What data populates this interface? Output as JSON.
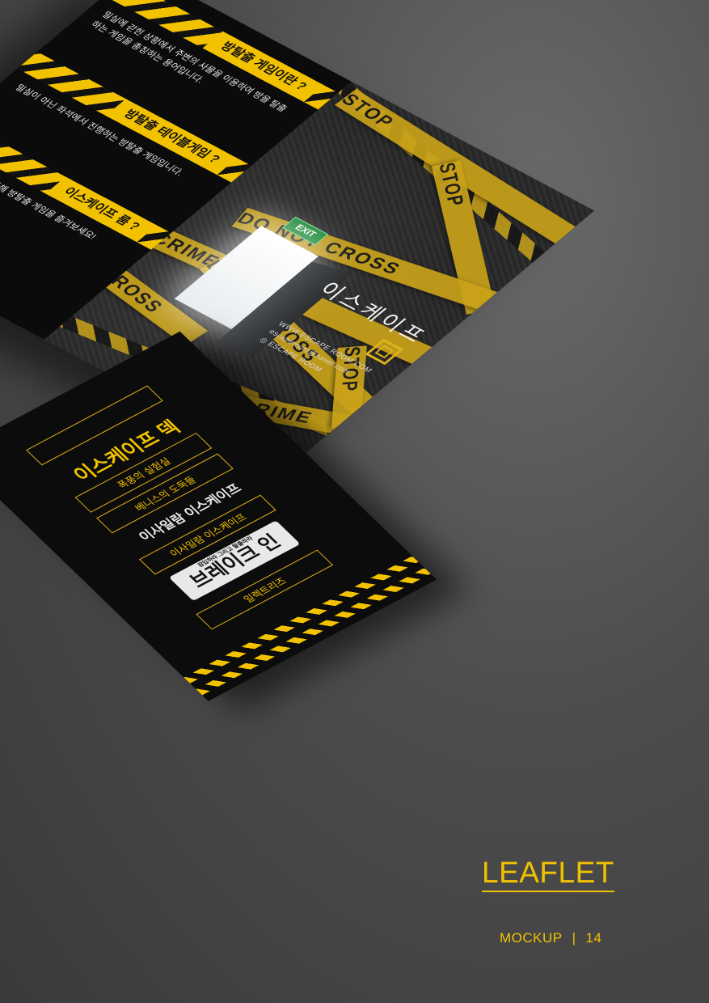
{
  "main_leaflet": {
    "left_panel": {
      "sections": [
        {
          "heading": "방탈출 게임이란 ?",
          "body": "밀실에 갇힌 상황에서 주변의 사물을 이용하여 방을 탈출하는 게임을 총칭하는 용어입니다."
        },
        {
          "heading": "방탈출 테이블게임 ?",
          "body": "밀실이 아닌 좌석에서 진행하는 방탈출 게임입니다."
        },
        {
          "heading": "이스케이프 룸 ?",
          "body": "이스케이프 룸을 통해 방탈출 게임을 즐겨보세요!"
        }
      ]
    },
    "right_panel": {
      "exit_sign": "EXIT",
      "tapes": [
        "STOP",
        "STOP",
        "DO NOT CROSS",
        "CRIME SCENE",
        "DO NOT CROSS",
        "CROSS",
        "CRIME",
        "STOP"
      ],
      "title": "이스케이프",
      "contacts": [
        "WWW.ESCAPE ROOM.COM",
        "escaperoom@naver.com",
        "ESCAPE ROOM"
      ]
    }
  },
  "second_leaflet": {
    "logo_text": "이스케이프 덱",
    "items": [
      "폭풍의 실험실",
      "베니스의 도둑들",
      "이사일람 이스케이프"
    ],
    "logo_banner": "이사일람 이스케이프",
    "breakin_top": "잠입하라 그리고 탈출하라",
    "breakin_title": "브레이크 인",
    "last_item": "일렉트리즈"
  },
  "caption": {
    "title": "LEAFLET",
    "subtitle": "MOCKUP",
    "separator": "|",
    "page_number": "14"
  },
  "colors": {
    "background": "#4d4d4d",
    "accent_yellow": "#f2c200",
    "tape_yellow": "#c9a21a",
    "paper_black": "#0b0b0b"
  }
}
